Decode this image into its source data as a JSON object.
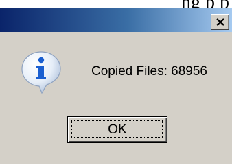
{
  "top_fragment": "ng p p",
  "dialog": {
    "message": "Copied Files: 68956",
    "ok_label": "OK"
  },
  "icons": {
    "close": "close-icon",
    "info": "information-icon"
  },
  "colors": {
    "title_start": "#0a246a",
    "title_end": "#a6caf0",
    "dialog_bg": "#d4d0c8",
    "info_blue": "#1a5fd0"
  }
}
